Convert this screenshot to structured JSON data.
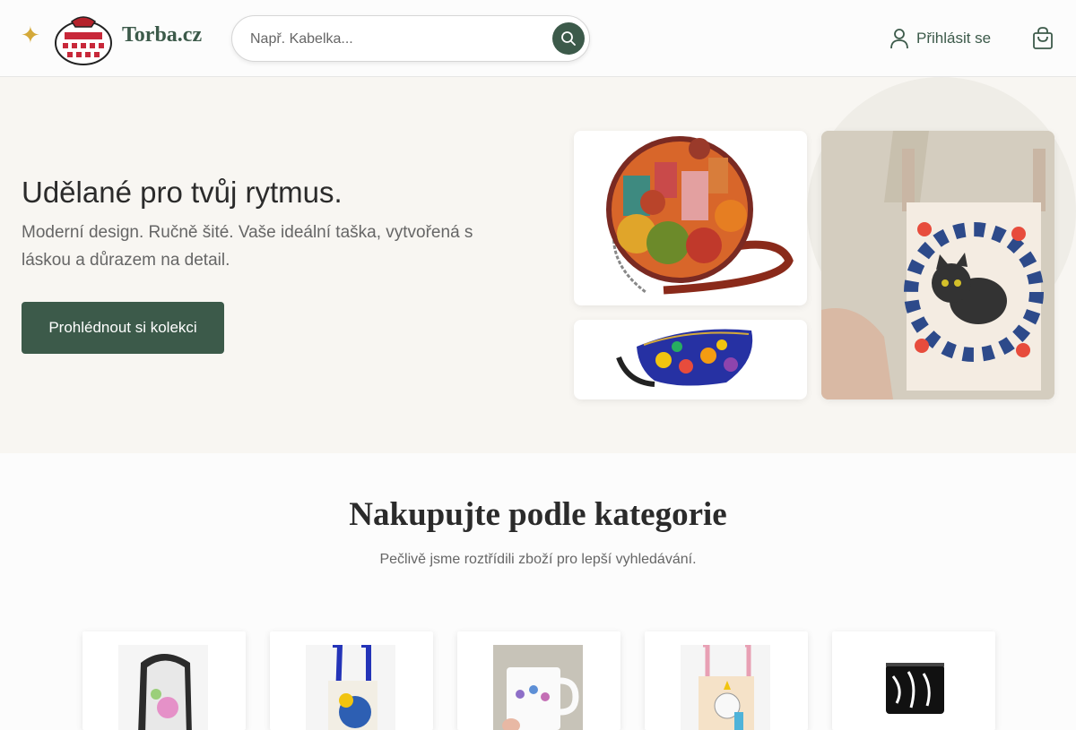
{
  "header": {
    "brand": "Torba.cz",
    "search": {
      "placeholder": "Např. Kabelka..."
    },
    "login_label": "Přihlásit se"
  },
  "icons": {
    "sparkle": "sparkle-icon",
    "search": "search-icon",
    "user": "user-icon",
    "cart": "shopping-bag-icon"
  },
  "hero": {
    "title": "Udělané pro tvůj rytmus.",
    "subtitle": "Moderní design. Ručně šité. Vaše ideální taška, vytvořená s láskou a důrazem na detail.",
    "cta_label": "Prohlédnout si kolekci"
  },
  "categories": {
    "title": "Nakupujte podle kategorie",
    "subtitle": "Pečlivě jsme roztřídili zboží pro lepší vyhledávání."
  },
  "colors": {
    "accent": "#3c5a4a",
    "sparkle": "#d4a93a",
    "hero_bg": "#f8f6f2"
  }
}
